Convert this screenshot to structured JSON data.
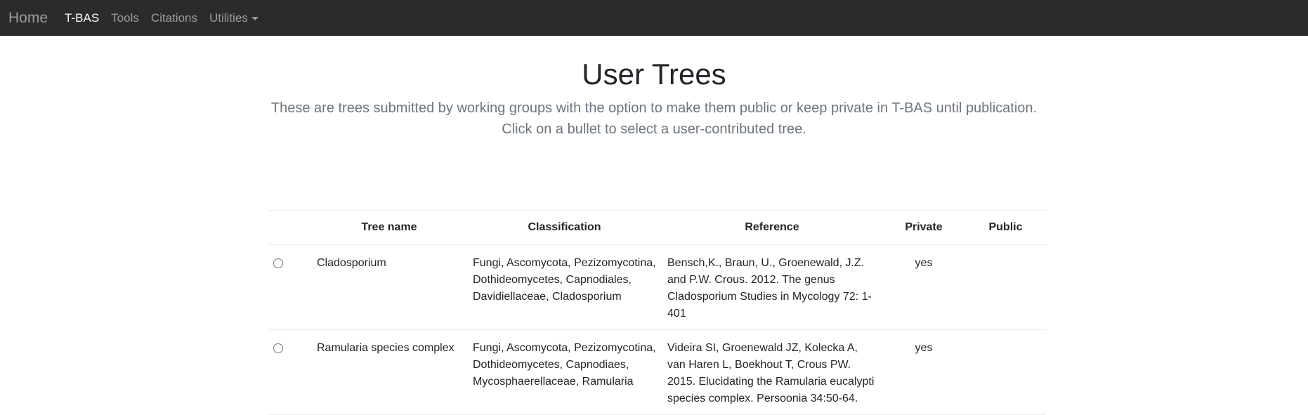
{
  "navbar": {
    "brand": "Home",
    "items": [
      {
        "label": "T-BAS",
        "active": true
      },
      {
        "label": "Tools",
        "active": false
      },
      {
        "label": "Citations",
        "active": false
      },
      {
        "label": "Utilities",
        "active": false,
        "dropdown": true
      }
    ]
  },
  "header": {
    "title": "User Trees",
    "lead": "These are trees submitted by working groups with the option to make them public or keep private in T-BAS until publication. Click on a bullet to select a user-contributed tree."
  },
  "table": {
    "columns": [
      "",
      "Tree name",
      "Classification",
      "Reference",
      "Private",
      "Public"
    ],
    "rows": [
      {
        "tree_name": "Cladosporium",
        "classification": "Fungi, Ascomycota, Pezizomycotina, Dothideomycetes, Capnodiales, Davidiellaceae, Cladosporium",
        "reference": "Bensch,K., Braun, U., Groenewald, J.Z. and P.W. Crous. 2012. The genus Cladosporium Studies in Mycology 72: 1-401",
        "private": "yes",
        "public": ""
      },
      {
        "tree_name": "Ramularia species complex",
        "classification": "Fungi, Ascomycota, Pezizomycotina, Dothideomycetes, Capnodiaes, Mycosphaerellaceae, Ramularia",
        "reference": "Videira SI, Groenewald JZ, Kolecka A, van Haren L, Boekhout T, Crous PW. 2015. Elucidating the Ramularia eucalypti species complex. Persoonia 34:50-64.",
        "private": "yes",
        "public": ""
      }
    ]
  },
  "colors": {
    "navbar_bg": "#2b2b2b",
    "nav_text": "#9d9d9d",
    "nav_active": "#ffffff",
    "lead_text": "#6c757d"
  }
}
